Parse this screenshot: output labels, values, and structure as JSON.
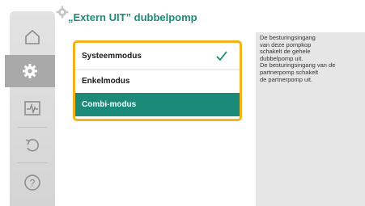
{
  "title": "„Extern UIT” dubbelpomp",
  "options": [
    {
      "label": "Systeemmodus",
      "checked": true,
      "selected": false
    },
    {
      "label": "Enkelmodus",
      "checked": false,
      "selected": false
    },
    {
      "label": "Combi-modus",
      "checked": false,
      "selected": true
    }
  ],
  "help_lines": [
    "De besturingsingang",
    "van deze pompkop",
    "schakelt de gehele",
    "dubbelpomp uit.",
    "De besturingsingang van de",
    "partnerpomp schakelt",
    "de partnerpomp uit."
  ],
  "nav": [
    {
      "icon": "home-icon",
      "active": false
    },
    {
      "icon": "settings-icon",
      "active": true
    },
    {
      "icon": "diagnostics-icon",
      "active": false
    },
    {
      "icon": "back-icon",
      "active": false
    },
    {
      "icon": "help-icon",
      "active": false
    }
  ],
  "colors": {
    "accent": "#1c8a78",
    "focus": "#f2b21b",
    "rail": "#dcdcdc",
    "rail_active": "#a9a9a9",
    "help_bg": "#e6e6e6"
  }
}
